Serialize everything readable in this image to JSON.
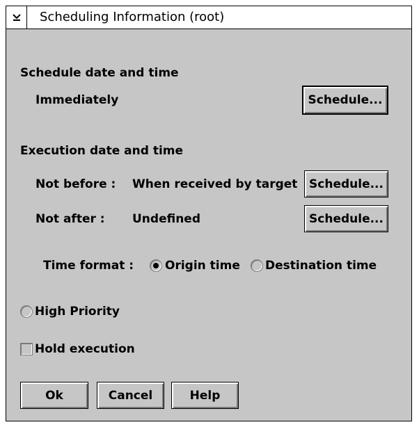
{
  "window": {
    "title": "Scheduling Information (root)",
    "sysmenu_icon": "system-menu-icon"
  },
  "schedule": {
    "heading": "Schedule date and time",
    "value": "Immediately",
    "button_label": "Schedule..."
  },
  "execution": {
    "heading": "Execution date and time",
    "not_before_label": "Not before :",
    "not_before_value": "When received by target",
    "not_before_button": "Schedule...",
    "not_after_label": "Not after :",
    "not_after_value": "Undefined",
    "not_after_button": "Schedule..."
  },
  "time_format": {
    "label": "Time format :",
    "options": [
      "Origin time",
      "Destination time"
    ],
    "selected": "Origin time"
  },
  "high_priority": {
    "label": "High Priority",
    "selected": false
  },
  "hold_execution": {
    "label": "Hold execution",
    "checked": false
  },
  "buttons": {
    "ok": "Ok",
    "cancel": "Cancel",
    "help": "Help"
  },
  "colors": {
    "dialog_background": "#c6c6c6",
    "titlebar_background": "#ffffff"
  }
}
